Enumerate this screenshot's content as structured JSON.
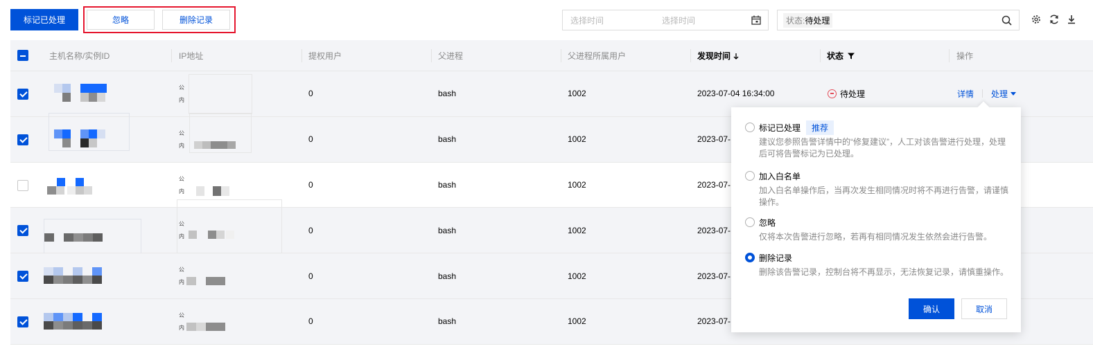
{
  "toolbar": {
    "mark_processed_label": "标记已处理",
    "ignore_label": "忽略",
    "delete_label": "删除记录",
    "date_start_placeholder": "选择时间",
    "date_end_placeholder": "选择时间",
    "search_tag_key": "状态:",
    "search_tag_value": "待处理",
    "icons": [
      "gear-icon",
      "refresh-icon",
      "download-icon"
    ]
  },
  "table": {
    "columns": [
      "主机名称/实例ID",
      "IP地址",
      "提权用户",
      "父进程",
      "父进程所属用户",
      "发现时间",
      "状态",
      "操作"
    ],
    "ip_public_tag": "公",
    "ip_private_tag": "内",
    "rows": [
      {
        "selected": true,
        "priv_user": "0",
        "parent_process": "bash",
        "parent_user": "1002",
        "found_time": "2023-07-04 16:34:00",
        "status": "待处理"
      },
      {
        "selected": true,
        "priv_user": "0",
        "parent_process": "bash",
        "parent_user": "1002",
        "found_time": "2023-07-"
      },
      {
        "selected": false,
        "priv_user": "0",
        "parent_process": "bash",
        "parent_user": "1002",
        "found_time": "2023-07-"
      },
      {
        "selected": true,
        "priv_user": "0",
        "parent_process": "bash",
        "parent_user": "1002",
        "found_time": "2023-07-"
      },
      {
        "selected": true,
        "priv_user": "0",
        "parent_process": "bash",
        "parent_user": "1002",
        "found_time": "2023-07-"
      },
      {
        "selected": true,
        "priv_user": "0",
        "parent_process": "bash",
        "parent_user": "1002",
        "found_time": "2023-07-"
      }
    ],
    "actions": {
      "detail": "详情",
      "process": "处理"
    }
  },
  "popover": {
    "options": [
      {
        "title": "标记已处理",
        "tag": "推荐",
        "desc": "建议您参照告警详情中的“修复建议”，人工对该告警进行处理，处理后可将告警标记为已处理。",
        "selected": false
      },
      {
        "title": "加入白名单",
        "desc": "加入白名单操作后，当再次发生相同情况时将不再进行告警，请谨慎操作。",
        "selected": false
      },
      {
        "title": "忽略",
        "desc": "仅将本次告警进行忽略，若再有相同情况发生依然会进行告警。",
        "selected": false
      },
      {
        "title": "删除记录",
        "desc": "删除该告警记录，控制台将不再显示，无法恢复记录，请慎重操作。",
        "selected": true
      }
    ],
    "confirm_label": "确认",
    "cancel_label": "取消"
  },
  "colors": {
    "primary": "#0052d9",
    "highlight_border": "#e5152d",
    "status_pending": "#e34d59"
  }
}
